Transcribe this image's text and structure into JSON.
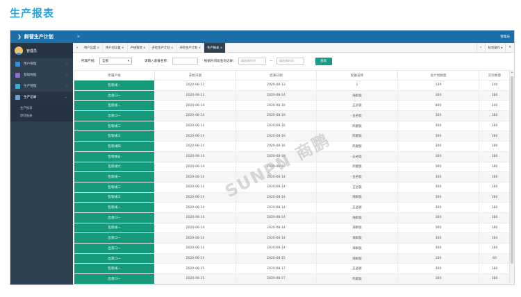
{
  "page_heading": "生产报表",
  "app": {
    "title": "鲜营生产计划",
    "user": "管理员",
    "topbar_right": "管理员"
  },
  "sidebar": {
    "items": [
      {
        "label": "用户管理",
        "color": "#3b8fd6"
      },
      {
        "label": "基础数据",
        "color": "#8a6fd6"
      },
      {
        "label": "生产管理",
        "color": "#3bb0d6"
      },
      {
        "label": "生产记录",
        "color": "#6fa0d6"
      }
    ],
    "sub_items": [
      "生产报表",
      "原料报表"
    ]
  },
  "tabs": {
    "items": [
      "用户设置 ×",
      "用户组设置 ×",
      "产线管理 ×",
      "开检生产计划 ×",
      "开检生产计划 ×",
      "生产报表 ×"
    ],
    "right_more": "»",
    "right_ops": "标签操作 ▾",
    "right_close": "✕",
    "left_nav": "«"
  },
  "filters": {
    "line_label": "所属产线：",
    "line_value": "全部",
    "name_label": "请输入套餐名称：",
    "name_value": "",
    "time_label": "根据时间段查询记录：",
    "start_placeholder": "请选择时间",
    "dash": "---",
    "end_placeholder": "请选择时间",
    "query_button": "查询"
  },
  "table": {
    "headers": [
      "所属产线",
      "开始日期",
      "结束日期",
      "套餐名称",
      "总计划数量",
      "实际数量"
    ],
    "rows": [
      [
        "包装线一",
        "2020-08-11",
        "2020-08-13",
        "1",
        "139",
        "240"
      ],
      [
        "出货口一",
        "2020-08-13",
        "2020-08-14",
        "海鲜饭",
        "300",
        "180"
      ],
      [
        "包装线一",
        "2020-08-14",
        "2020-08-16",
        "五谷饭",
        "800",
        "240"
      ],
      [
        "出货口一",
        "2020-08-14",
        "2020-08-16",
        "五谷饭",
        "300",
        "180"
      ],
      [
        "包装线二",
        "2020-08-14",
        "2020-08-16",
        "鸡腿饭",
        "300",
        "180"
      ],
      [
        "包装线三",
        "2020-08-14",
        "2020-08-16",
        "鸡腿饭",
        "300",
        "180"
      ],
      [
        "包装线四",
        "2020-08-14",
        "2020-08-16",
        "鸡腿饭",
        "300",
        "180"
      ],
      [
        "包装线五",
        "2020-08-14",
        "2020-08-16",
        "五谷饭",
        "300",
        "180"
      ],
      [
        "包装线六",
        "2020-08-14",
        "2020-08-16",
        "鸡腿饭",
        "300",
        "180"
      ],
      [
        "包装线一",
        "2020-08-14",
        "2020-08-14",
        "五谷饭",
        "300",
        "180"
      ],
      [
        "包装线二",
        "2020-08-14",
        "2020-08-14",
        "五谷饭",
        "300",
        "180"
      ],
      [
        "包装线三",
        "2020-08-14",
        "2020-08-14",
        "海鲜饭",
        "300",
        "180"
      ],
      [
        "包装线一",
        "2020-08-14",
        "2020-08-14",
        "五谷饭",
        "300",
        "180"
      ],
      [
        "出货口一",
        "2020-08-14",
        "2020-08-14",
        "海鲜饭",
        "300",
        "180"
      ],
      [
        "包装线一",
        "2020-08-14",
        "2020-08-14",
        "海鲜饭",
        "300",
        "180"
      ],
      [
        "出货口一",
        "2020-08-14",
        "2020-08-14",
        "海鲜饭",
        "300",
        "184"
      ],
      [
        "出货口一",
        "2020-08-14",
        "2020-08-14",
        "海鲜饭",
        "300",
        "180"
      ],
      [
        "出货口一",
        "2020-08-14",
        "2020-08-15",
        "海鲜饭",
        "100",
        "60"
      ],
      [
        "包装线一",
        "2020-08-15",
        "2020-08-17",
        "五谷饭",
        "300",
        "180"
      ],
      [
        "出货口一",
        "2020-08-15",
        "2020-08-17",
        "鸡腿饭",
        "300",
        "180"
      ]
    ]
  },
  "watermark": "SUNPN 商鹏"
}
